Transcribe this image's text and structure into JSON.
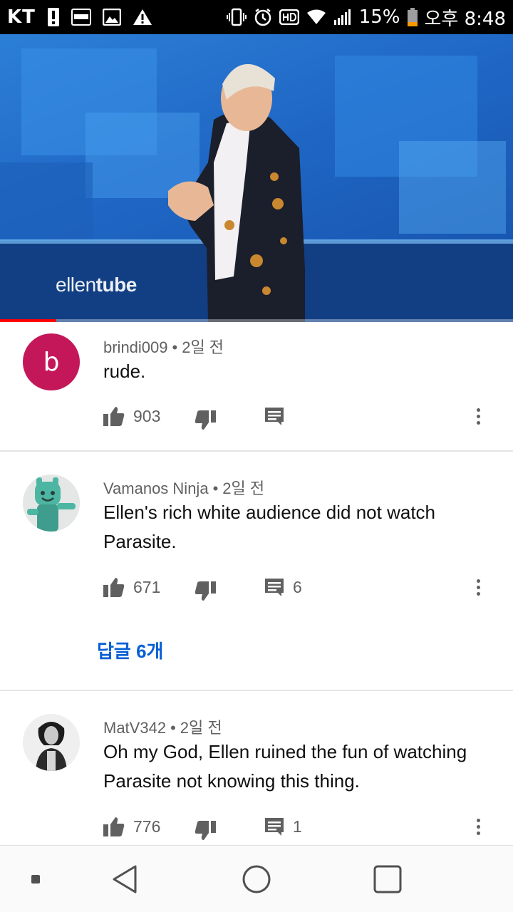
{
  "status_bar": {
    "carrier": "KT",
    "battery": "15%",
    "time": "오후 8:48",
    "icons": [
      "alert-icon",
      "payco-icon",
      "image-icon",
      "warning-icon",
      "vibrate-icon",
      "alarm-icon",
      "hd-icon",
      "wifi-icon",
      "signal-icon",
      "battery-icon"
    ]
  },
  "video": {
    "watermark_light": "ellen",
    "watermark_bold": "tube",
    "progress": 0.11
  },
  "comments": [
    {
      "author": "brindi009",
      "time": "2일 전",
      "text": "rude.",
      "avatar_letter": "b",
      "avatar_color": "#c4175a",
      "likes": "903",
      "reply_count": ""
    },
    {
      "author": "Vamanos Ninja",
      "time": "2일 전",
      "text": "Ellen's rich white audience did not watch Parasite.",
      "likes": "671",
      "reply_count": "6",
      "replies_link": "답글 6개"
    },
    {
      "author": "MatV342",
      "time": "2일 전",
      "text": "Oh my God, Ellen ruined the fun of watching Parasite not knowing this thing.",
      "likes": "776",
      "reply_count": "1"
    }
  ],
  "colors": {
    "meta_text": "#606060",
    "link": "#065fd4",
    "progress": "#ff0000"
  }
}
